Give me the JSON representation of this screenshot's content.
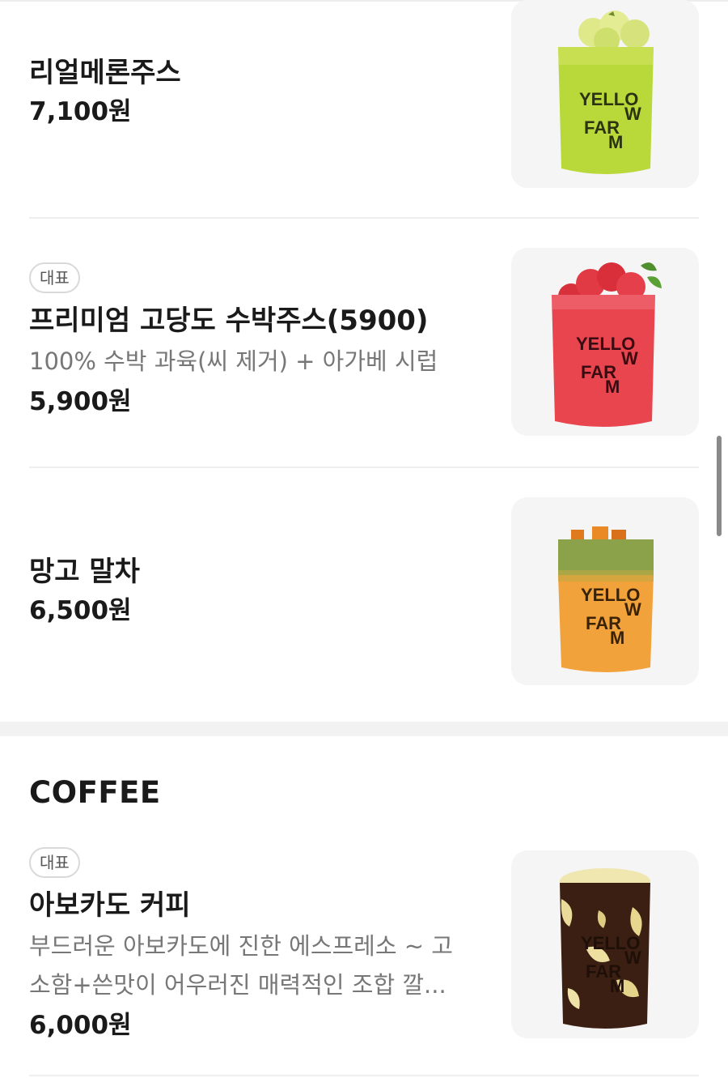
{
  "items_top": [
    {
      "badge": "",
      "name": "리얼메론주스",
      "description": "",
      "price": "7,100원",
      "image_icon": "melon-juice-cup"
    },
    {
      "badge": "대표",
      "name": "프리미엄 고당도 수박주스(5900)",
      "description": "100% 수박 과육(씨 제거) + 아가베 시럽",
      "price": "5,900원",
      "image_icon": "watermelon-juice-cup"
    },
    {
      "badge": "",
      "name": "망고 말차",
      "description": "",
      "price": "6,500원",
      "image_icon": "mango-matcha-cup"
    }
  ],
  "section": {
    "title": "COFFEE"
  },
  "items_coffee": [
    {
      "badge": "대표",
      "name": "아보카도 커피",
      "description_line1": "부드러운 아보카도에 진한 에스프레소 ~ 고",
      "description_line2": "소함+쓴맛이 어우러진 매력적인 조합 깔...",
      "price": "6,000원",
      "image_icon": "avocado-coffee-cup"
    }
  ],
  "cup_logo": {
    "line1": "YELLO",
    "line2": "W",
    "line3": "FAR",
    "line4": "M"
  },
  "colors": {
    "melon": "#b9d83a",
    "watermelon": "#e8454f",
    "mango": "#f2a23a",
    "matcha": "#8ba24a",
    "coffee": "#3b1f12",
    "avocado": "#efe6b0"
  }
}
